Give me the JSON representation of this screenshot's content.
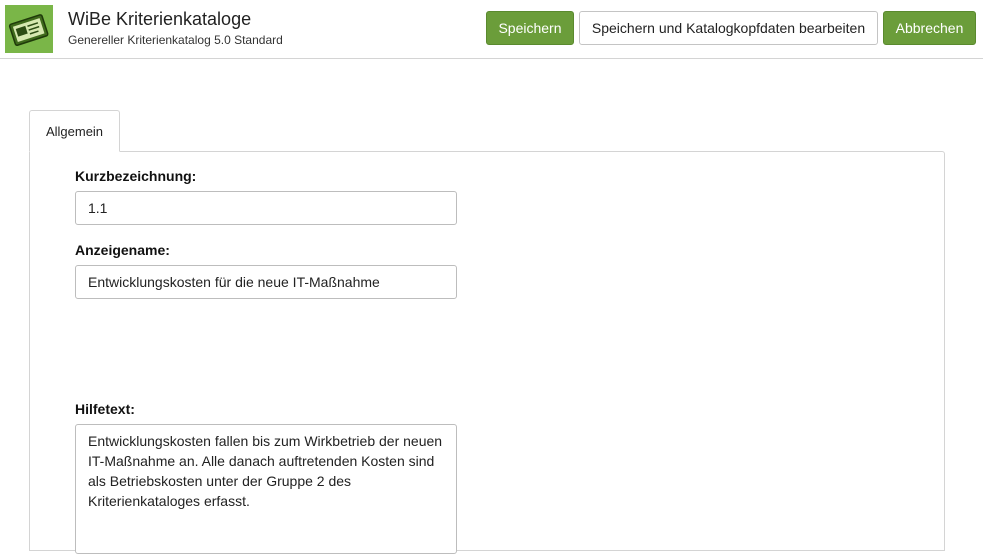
{
  "header": {
    "title": "WiBe Kriterienkataloge",
    "subtitle": "Genereller Kriterienkatalog 5.0 Standard",
    "logo_icon": "catalog-logo-icon",
    "buttons": {
      "save": "Speichern",
      "save_and_edit": "Speichern und Katalogkopfdaten bearbeiten",
      "cancel": "Abbrechen"
    }
  },
  "tabs": [
    {
      "label": "Allgemein",
      "active": true
    }
  ],
  "form": {
    "short_name": {
      "label": "Kurzbezeichnung:",
      "value": "1.1"
    },
    "display_name": {
      "label": "Anzeigename:",
      "value": "Entwicklungskosten für die neue IT-Maßnahme"
    },
    "help_text": {
      "label": "Hilfetext:",
      "value": "Entwicklungskosten fallen bis zum Wirkbetrieb der neuen IT-Maßnahme an. Alle danach auftretenden Kosten sind als Betriebskosten unter der Gruppe 2 des Kriterienkataloges erfasst."
    }
  },
  "colors": {
    "accent_green": "#6b9d3a",
    "logo_green": "#7ab648",
    "border": "#d4d4d4"
  }
}
